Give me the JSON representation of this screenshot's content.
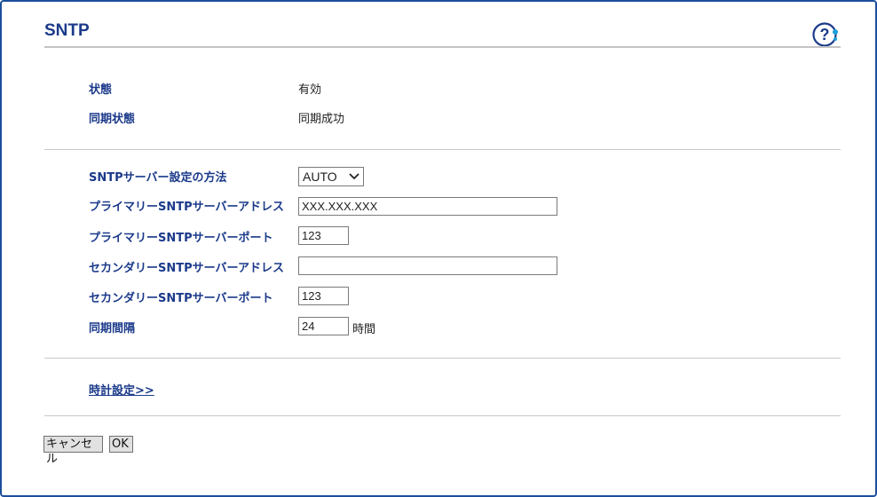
{
  "page": {
    "title": "SNTP",
    "help_icon": "help-question-icon",
    "accent_color": "#1b3a8a"
  },
  "status": {
    "state_label": "状態",
    "state_value": "有効",
    "sync_label": "同期状態",
    "sync_value": "同期成功"
  },
  "settings": {
    "method_label": "SNTPサーバー設定の方法",
    "method_value": "AUTO",
    "primary_address_label": "プライマリーSNTPサーバーアドレス",
    "primary_address_value": "XXX.XXX.XXX",
    "primary_port_label": "プライマリーSNTPサーバーポート",
    "primary_port_value": "123",
    "secondary_address_label": "セカンダリーSNTPサーバーアドレス",
    "secondary_address_value": "",
    "secondary_port_label": "セカンダリーSNTPサーバーポート",
    "secondary_port_value": "123",
    "interval_label": "同期間隔",
    "interval_value": "24",
    "interval_unit": "時間"
  },
  "links": {
    "clock_settings": "時計設定>>"
  },
  "buttons": {
    "cancel": "キャンセル",
    "ok": "OK"
  }
}
